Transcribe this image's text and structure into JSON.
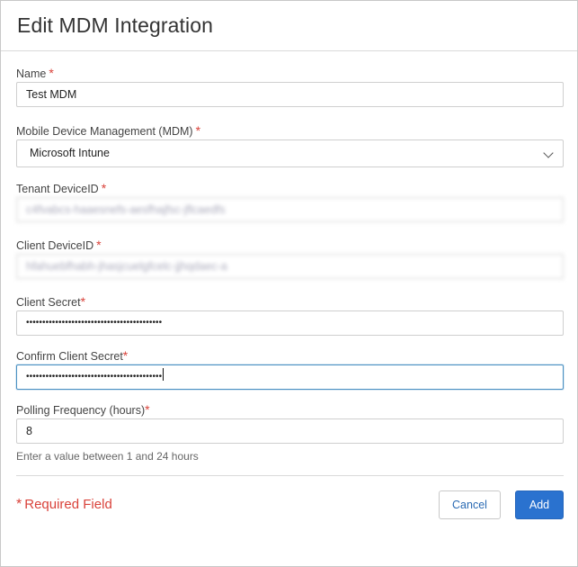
{
  "dialog": {
    "title": "Edit MDM Integration",
    "required_marker": "*"
  },
  "fields": {
    "name": {
      "label": "Name",
      "value": "Test MDM"
    },
    "mdm": {
      "label": "Mobile Device Management (MDM)",
      "selected": "Microsoft Intune"
    },
    "tenant_id": {
      "label": "Tenant DeviceID",
      "value": "c4fvabcs-haaesnefs-aesfhajfsc-jflcaedfs"
    },
    "client_id": {
      "label": "Client DeviceID",
      "value": "hfahuebfhabh-jhasjcuelgfcelc-jjhqdaec-a"
    },
    "client_secret": {
      "label": "Client Secret",
      "value": "••••••••••••••••••••••••••••••••••••••••••"
    },
    "confirm_secret": {
      "label": "Confirm Client Secret",
      "value": "••••••••••••••••••••••••••••••••••••••••••"
    },
    "polling": {
      "label": "Polling Frequency (hours)",
      "value": "8",
      "help": "Enter a value between 1 and 24 hours"
    }
  },
  "footer": {
    "required_note": "Required Field",
    "cancel_label": "Cancel",
    "add_label": "Add"
  },
  "colors": {
    "required": "#d9423a",
    "primary": "#2a72cf",
    "link": "#2a6ab3"
  }
}
